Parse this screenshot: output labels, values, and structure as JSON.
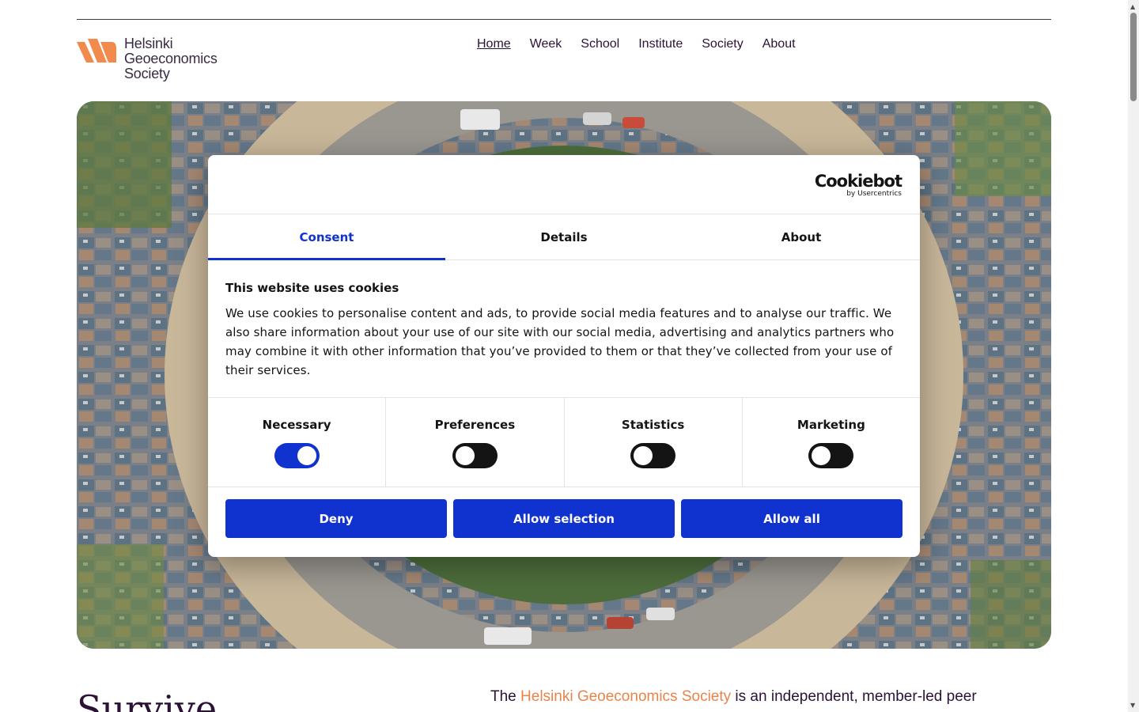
{
  "logo": {
    "line1": "Helsinki",
    "line2": "Geoeconomics",
    "line3": "Society",
    "mark_color": "#F28A4E"
  },
  "nav": {
    "items": [
      {
        "label": "Home",
        "active": true
      },
      {
        "label": "Week"
      },
      {
        "label": "School"
      },
      {
        "label": "Institute"
      },
      {
        "label": "Society"
      },
      {
        "label": "About"
      }
    ]
  },
  "dialog": {
    "brand_main": "Cookiebot",
    "brand_sub": "by Usercentrics",
    "tabs": [
      {
        "label": "Consent",
        "active": true
      },
      {
        "label": "Details"
      },
      {
        "label": "About"
      }
    ],
    "title": "This website uses cookies",
    "text": "We use cookies to personalise content and ads, to provide social media features and to analyse our traffic. We also share information about your use of our site with our social media, advertising and analytics partners who may combine it with other information that you’ve provided to them or that they’ve collected from your use of their services.",
    "categories": [
      {
        "label": "Necessary",
        "enabled": true
      },
      {
        "label": "Preferences",
        "enabled": false
      },
      {
        "label": "Statistics",
        "enabled": false
      },
      {
        "label": "Marketing",
        "enabled": false
      }
    ],
    "buttons": {
      "deny": "Deny",
      "allow_selection": "Allow selection",
      "allow_all": "Allow all"
    },
    "accent_color": "#1032CF"
  },
  "below": {
    "heading": "Survive",
    "intro_pre": "The ",
    "intro_highlight": "Helsinki Geoeconomics Society",
    "intro_post": " is an independent, member-led peer"
  },
  "icons": {
    "logo": "hgs-logo-mark-icon",
    "scroll_up": "triangle-up-icon",
    "scroll_down": "triangle-down-icon"
  }
}
